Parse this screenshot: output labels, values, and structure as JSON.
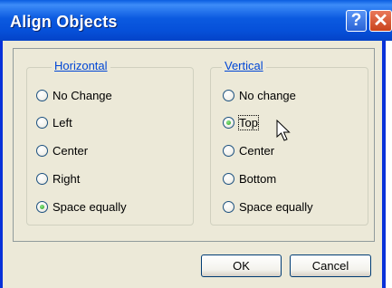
{
  "window": {
    "title": "Align Objects",
    "help_glyph": "?",
    "close_glyph": "✕"
  },
  "horizontal": {
    "legend": "Horizontal",
    "options": [
      {
        "label": "No Change",
        "selected": false
      },
      {
        "label": "Left",
        "selected": false
      },
      {
        "label": "Center",
        "selected": false
      },
      {
        "label": "Right",
        "selected": false
      },
      {
        "label": "Space equally",
        "selected": true
      }
    ]
  },
  "vertical": {
    "legend": "Vertical",
    "options": [
      {
        "label": "No change",
        "selected": false
      },
      {
        "label": "Top",
        "selected": true
      },
      {
        "label": "Center",
        "selected": false
      },
      {
        "label": "Bottom",
        "selected": false
      },
      {
        "label": "Space equally",
        "selected": false
      }
    ]
  },
  "buttons": {
    "ok": "OK",
    "cancel": "Cancel"
  }
}
